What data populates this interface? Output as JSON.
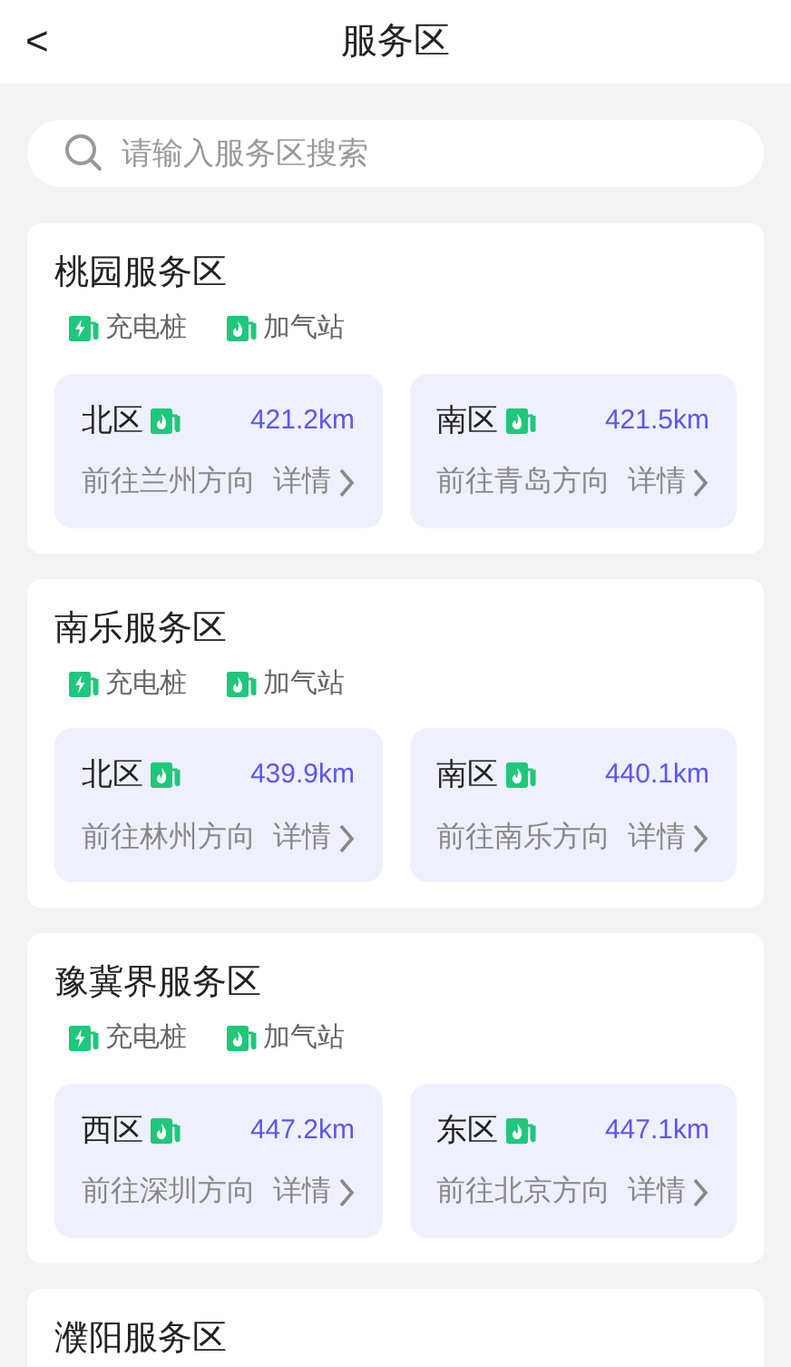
{
  "header": {
    "back": "<",
    "title": "服务区"
  },
  "search": {
    "placeholder": "请输入服务区搜索"
  },
  "areas": [
    {
      "name": "桃园服务区",
      "facilities": [
        {
          "kind": "charging",
          "label": "充电桩"
        },
        {
          "kind": "gas",
          "label": "加气站"
        }
      ],
      "zones": [
        {
          "name": "北区",
          "distance": "421.2km",
          "direction": "前往兰州方向",
          "details": "详情"
        },
        {
          "name": "南区",
          "distance": "421.5km",
          "direction": "前往青岛方向",
          "details": "详情"
        }
      ]
    },
    {
      "name": "南乐服务区",
      "facilities": [
        {
          "kind": "charging",
          "label": "充电桩"
        },
        {
          "kind": "gas",
          "label": "加气站"
        }
      ],
      "zones": [
        {
          "name": "北区",
          "distance": "439.9km",
          "direction": "前往林州方向",
          "details": "详情"
        },
        {
          "name": "南区",
          "distance": "440.1km",
          "direction": "前往南乐方向",
          "details": "详情"
        }
      ]
    },
    {
      "name": "豫冀界服务区",
      "facilities": [
        {
          "kind": "charging",
          "label": "充电桩"
        },
        {
          "kind": "gas",
          "label": "加气站"
        }
      ],
      "zones": [
        {
          "name": "西区",
          "distance": "447.2km",
          "direction": "前往深圳方向",
          "details": "详情"
        },
        {
          "name": "东区",
          "distance": "447.1km",
          "direction": "前往北京方向",
          "details": "详情"
        }
      ]
    },
    {
      "name": "濮阳服务区"
    }
  ]
}
